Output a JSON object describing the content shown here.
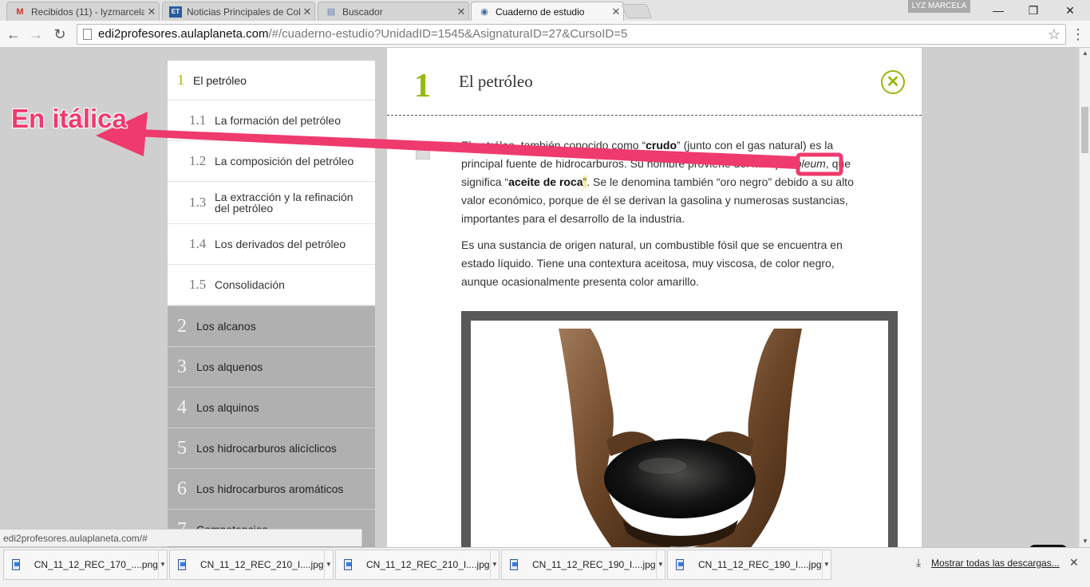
{
  "browser": {
    "tabs": [
      {
        "label": "Recibidos (11) - lyzmarcela",
        "icon": "gmail-icon",
        "favicon": "M"
      },
      {
        "label": "Noticias Principales de Col",
        "icon": "news-icon",
        "favicon": "ET"
      },
      {
        "label": "Buscador",
        "icon": "page-icon",
        "favicon": "▤"
      },
      {
        "label": "Cuaderno de estudio",
        "icon": "globe-icon",
        "favicon": "◉"
      }
    ],
    "close_glyph": "✕",
    "profile_name": "LYZ MARCELA",
    "url_host": "edi2profesores.aulaplaneta.com",
    "url_rest": "/#/cuaderno-estudio?UnidadID=1545&AsignaturaID=27&CursoID=5",
    "status_url": "edi2profesores.aulaplaneta.com/#"
  },
  "sidebar": {
    "main": {
      "num": "1",
      "label": "El petróleo"
    },
    "subs": [
      {
        "num": "1.1",
        "label": "La formación del petróleo"
      },
      {
        "num": "1.2",
        "label": "La composición del petróleo"
      },
      {
        "num": "1.3",
        "label": "La extracción y la refinación del petróleo"
      },
      {
        "num": "1.4",
        "label": "Los derivados del petróleo"
      },
      {
        "num": "1.5",
        "label": "Consolidación"
      }
    ],
    "units": [
      {
        "num": "2",
        "label": "Los alcanos"
      },
      {
        "num": "3",
        "label": "Los alquenos"
      },
      {
        "num": "4",
        "label": "Los alquinos"
      },
      {
        "num": "5",
        "label": "Los hidrocarburos alicíclicos"
      },
      {
        "num": "6",
        "label": "Los hidrocarburos aromáticos"
      },
      {
        "num": "7",
        "label": "Competencias"
      }
    ]
  },
  "content": {
    "unit_num": "1",
    "title": "El petróleo",
    "p1": {
      "a": "El petróleo, también conocido como “",
      "b": "crudo",
      "c": "” (junto con el gas natural) es la principal fuente de hidrocarburos. Su nombre proviene del latín ",
      "d": "petroleum",
      "e": ", que significa “",
      "f": "aceite de roca",
      "g": "”",
      "h": ". Se le denomina también “oro negro” debido a su alto valor económico, porque de él se derivan la gasolina y numerosas sustancias, importantes para el desarrollo de la industria."
    },
    "p2": "Es una sustancia de origen natural, un combustible fósil que se encuentra en estado líquido. Tiene una contextura aceitosa, muy viscosa, de color negro, aunque ocasionalmente presenta color amarillo."
  },
  "annotation": {
    "text": "En itálica",
    "color": "#ef3a6d"
  },
  "downloads": {
    "items": [
      "CN_11_12_REC_170_....png",
      "CN_11_12_REC_210_I....jpg",
      "CN_11_12_REC_210_I....jpg",
      "CN_11_12_REC_190_I....jpg",
      "CN_11_12_REC_190_I....jpg"
    ],
    "show_all": "Mostrar todas las descargas..."
  },
  "colors": {
    "accent": "#97b80d",
    "annotation": "#ef3a6d"
  }
}
